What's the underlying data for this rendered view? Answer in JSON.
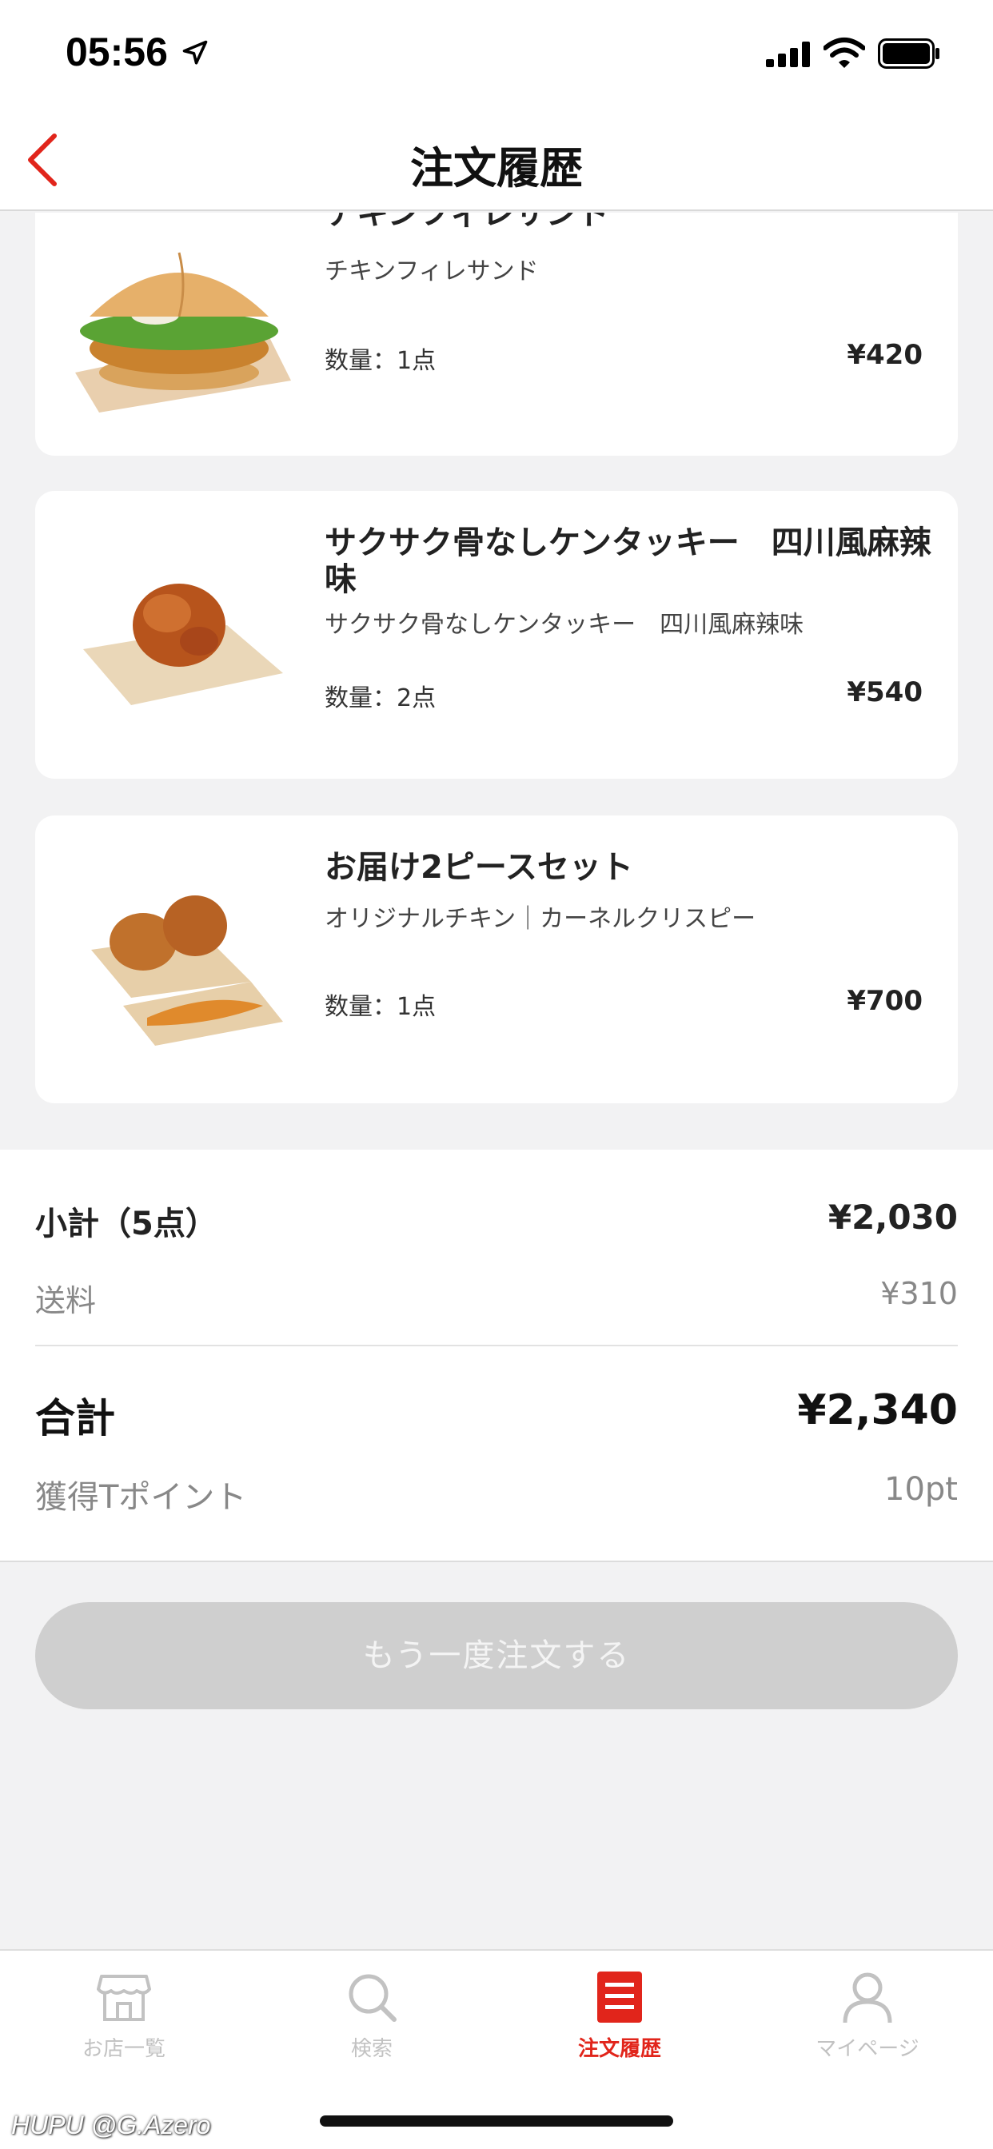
{
  "status_bar": {
    "time": "05:56"
  },
  "nav": {
    "title": "注文履歴"
  },
  "items": [
    {
      "name": "チキンフィレサンド",
      "description": "チキンフィレサンド",
      "quantity": "数量：1点",
      "price": "¥420"
    },
    {
      "name": "サクサク骨なしケンタッキー　四川風麻辣味",
      "description": "サクサク骨なしケンタッキー　四川風麻辣味",
      "quantity": "数量：2点",
      "price": "¥540"
    },
    {
      "name": "お届け2ピースセット",
      "description": "オリジナルチキン｜カーネルクリスピー",
      "quantity": "数量：1点",
      "price": "¥700"
    }
  ],
  "summary": {
    "subtotal_label": "小計（5点）",
    "subtotal_value": "¥2,030",
    "shipping_label": "送料",
    "shipping_value": "¥310",
    "total_label": "合計",
    "total_value": "¥2,340",
    "points_label": "獲得Tポイント",
    "points_value": "10pt"
  },
  "reorder_button": "もう一度注文する",
  "tabs": [
    {
      "label": "お店一覧",
      "icon": "store-icon",
      "active": false
    },
    {
      "label": "検索",
      "icon": "search-icon",
      "active": false
    },
    {
      "label": "注文履歴",
      "icon": "order-history-icon",
      "active": true
    },
    {
      "label": "マイページ",
      "icon": "person-icon",
      "active": false
    }
  ],
  "watermark": "HUPU @G.Azero",
  "colors": {
    "accent": "#e1251b",
    "background": "#f2f2f3",
    "button_disabled": "#cfcfcf"
  }
}
